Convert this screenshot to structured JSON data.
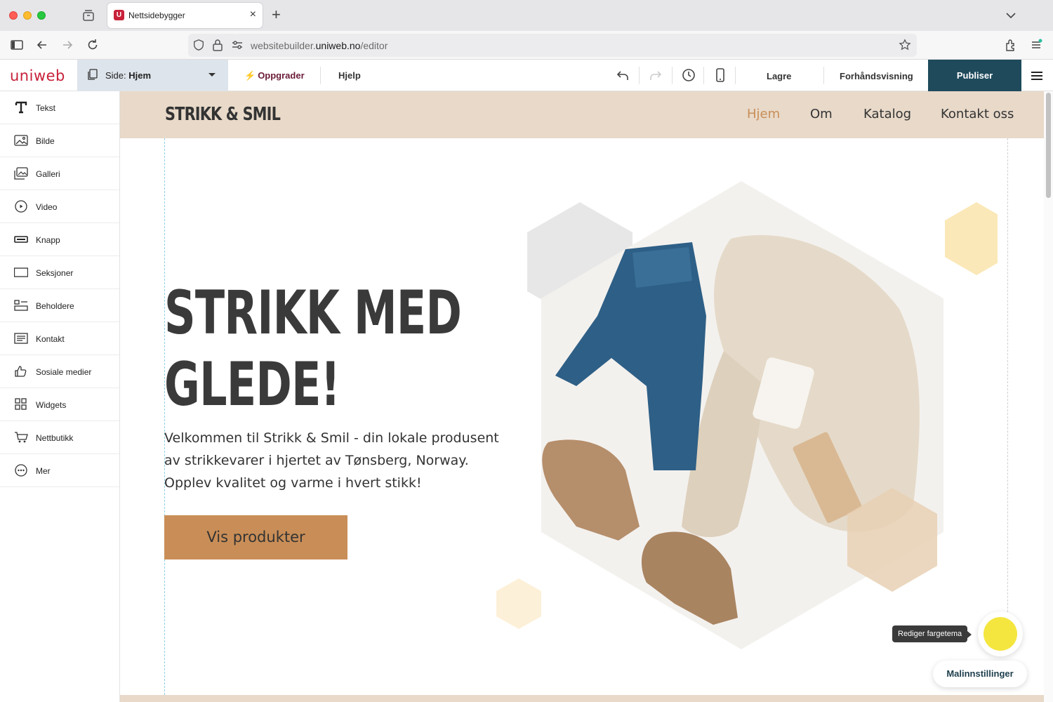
{
  "browser": {
    "tab_title": "Nettsidebygger",
    "tab_favicon": "U",
    "url_prefix": "websitebuilder.",
    "url_domain": "uniweb.no",
    "url_path": "/editor"
  },
  "editor": {
    "logo": "uniweb",
    "page_prefix": "Side: ",
    "page_name": "Hjem",
    "upgrade": "Oppgrader",
    "help": "Hjelp",
    "save": "Lagre",
    "preview": "Forhåndsvisning",
    "publish": "Publiser",
    "accent": "#1e4a5c"
  },
  "sidebar": {
    "items": [
      {
        "label": "Tekst",
        "icon": "text-icon"
      },
      {
        "label": "Bilde",
        "icon": "image-icon"
      },
      {
        "label": "Galleri",
        "icon": "gallery-icon"
      },
      {
        "label": "Video",
        "icon": "video-icon"
      },
      {
        "label": "Knapp",
        "icon": "button-icon"
      },
      {
        "label": "Seksjoner",
        "icon": "sections-icon"
      },
      {
        "label": "Beholdere",
        "icon": "containers-icon"
      },
      {
        "label": "Kontakt",
        "icon": "contact-icon"
      },
      {
        "label": "Sosiale medier",
        "icon": "thumbs-up-icon"
      },
      {
        "label": "Widgets",
        "icon": "widgets-icon"
      },
      {
        "label": "Nettbutikk",
        "icon": "cart-icon"
      },
      {
        "label": "Mer",
        "icon": "more-icon"
      }
    ]
  },
  "site": {
    "logo": "STRIKK & SMIL",
    "nav": [
      "Hjem",
      "Om",
      "Katalog",
      "Kontakt oss"
    ],
    "active_nav": "Hjem",
    "hero_line1": "STRIKK MED",
    "hero_line2": "GLEDE!",
    "hero_text": "Velkommen til Strikk & Smil - din lokale produsent av strikkevarer i hjertet av Tønsberg, Norway. Opplev kvalitet og varme i hvert stikk!",
    "cta": "Vis produkter",
    "header_bg": "#e8d9c9",
    "cta_bg": "#c98e57"
  },
  "overlay": {
    "tooltip": "Rediger fargetema",
    "template_settings": "Malinnstillinger"
  }
}
